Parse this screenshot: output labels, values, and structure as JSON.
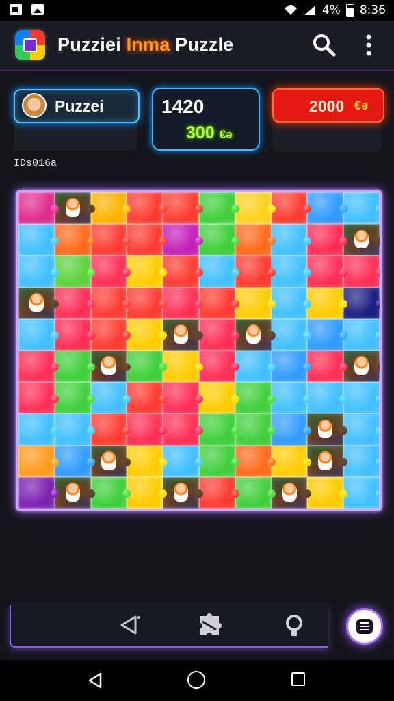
{
  "status_bar": {
    "battery_text": "4%",
    "time": "8:36"
  },
  "app_bar": {
    "title_part1": "Puzziei ",
    "title_highlight": "Inma",
    "title_part2": " Puzzle",
    "search_icon": "search-icon",
    "more_icon": "more-vert-icon"
  },
  "panels": {
    "user_name": "Puzzei",
    "score_main": "1420",
    "score_sub": "300",
    "score_sub_icon": "€ə",
    "coins_value": "2000",
    "coins_icon": "€ə"
  },
  "level_label": "IDs016a",
  "colors": {
    "accent_purple": "#a25cff",
    "accent_blue": "#3fb7ff",
    "accent_red": "#e51a12",
    "accent_green": "#b8ff3a"
  },
  "board": {
    "rows": 10,
    "cols": 10,
    "pieces": [
      "#e02a8c",
      "img",
      "#ffb300",
      "#ff3a30",
      "#ff3a30",
      "#3fcf3a",
      "#ffd21a",
      "#ff3a30",
      "#2f9bff",
      "#3fbfff",
      "#3fbfff",
      "#ff6a1a",
      "#ff3a30",
      "#ff3a30",
      "#c21fb8",
      "#3fcf3a",
      "#ff6a1a",
      "#3fbfff",
      "#ff2d55",
      "img",
      "#3fbfff",
      "#5ad23a",
      "#ff2d55",
      "#ffcc00",
      "#ff3a30",
      "#3fbfff",
      "#ff3a30",
      "#3fbfff",
      "#ff2d55",
      "#ff2d55",
      "img",
      "#ff2d55",
      "#ff3a30",
      "#ff3a30",
      "#ff2d55",
      "#ff3a30",
      "#ffcc00",
      "#3fbfff",
      "#ffcc00",
      "#1a1d80",
      "#3fbfff",
      "#ff2d55",
      "#ff3a30",
      "#ffcc00",
      "img",
      "#ff2d55",
      "img",
      "#3fbfff",
      "#2f9bff",
      "#3fbfff",
      "#ff2d55",
      "#3fcf3a",
      "img",
      "#3fcf3a",
      "#ffcc00",
      "#ff2d55",
      "#3fbfff",
      "#2f9bff",
      "#ff2d55",
      "img",
      "#ff2d55",
      "#3fcf3a",
      "#3fbfff",
      "#ff3a30",
      "#ff2d55",
      "#ffcc00",
      "#3fcf3a",
      "#3fbfff",
      "#3fbfff",
      "#3fbfff",
      "#3fbfff",
      "#3fbfff",
      "#ff3a30",
      "#ff2d55",
      "#ff2d55",
      "#3fcf3a",
      "#3fcf3a",
      "#2f9bff",
      "img",
      "#3fbfff",
      "#ff9a1a",
      "#2f9bff",
      "img",
      "#ffcc00",
      "#3fbfff",
      "#3fcf3a",
      "#ff6a1a",
      "#ffcc00",
      "img",
      "#3fbfff",
      "#7a1fb0",
      "img",
      "#3fcf3a",
      "#ffcc00",
      "img",
      "#ff3a30",
      "#3fcf3a",
      "img",
      "#ffcc00",
      "#3fbfff"
    ]
  },
  "bottom_bar": {
    "back_icon": "back-icon",
    "pieces_icon": "puzzle-pieces-icon",
    "hint_icon": "hint-bulb-icon",
    "menu_icon": "menu-icon"
  },
  "system_nav": {
    "back_icon": "system-back-icon",
    "home_icon": "system-home-icon",
    "recents_icon": "system-recents-icon"
  }
}
